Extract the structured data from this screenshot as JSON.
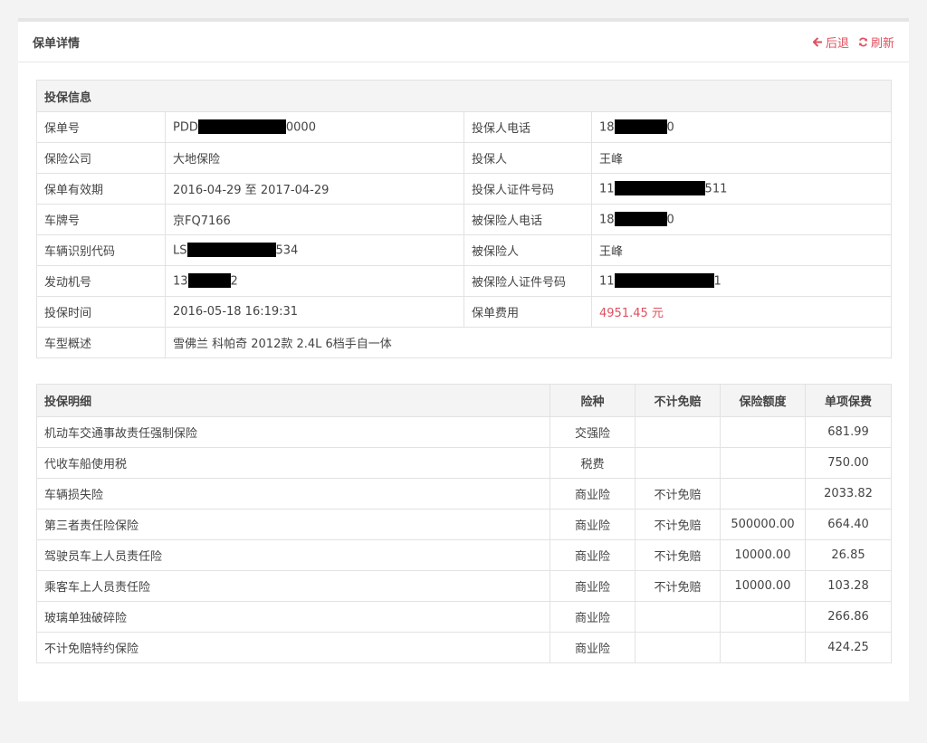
{
  "header": {
    "title": "保单详情",
    "back_label": "后退",
    "refresh_label": "刷新",
    "accent_color": "#e0505f"
  },
  "info": {
    "section_title": "投保信息",
    "rows": [
      {
        "label1": "保单号",
        "value1_prefix": "PDD",
        "value1_suffix": "0000",
        "label2": "投保人电话",
        "value2_prefix": "18",
        "value2_suffix": "0"
      },
      {
        "label1": "保险公司",
        "value1": "大地保险",
        "label2": "投保人",
        "value2": "王峰"
      },
      {
        "label1": "保单有效期",
        "value1": "2016-04-29 至 2017-04-29",
        "label2": "投保人证件号码",
        "value2_prefix": "11",
        "value2_suffix": "511"
      },
      {
        "label1": "车牌号",
        "value1": "京FQ7166",
        "label2": "被保险人电话",
        "value2_prefix": "18",
        "value2_suffix": "0"
      },
      {
        "label1": "车辆识别代码",
        "value1_prefix": "LS",
        "value1_suffix": "534",
        "label2": "被保险人",
        "value2": "王峰"
      },
      {
        "label1": "发动机号",
        "value1_prefix": "13",
        "value1_suffix": "2",
        "label2": "被保险人证件号码",
        "value2_prefix": "11",
        "value2_suffix": "1"
      },
      {
        "label1": "投保时间",
        "value1": "2016-05-18 16:19:31",
        "label2": "保单费用",
        "value2": "4951.45 元"
      },
      {
        "label1": "车型概述",
        "value1": "雪佛兰 科帕奇 2012款 2.4L 6档手自一体"
      }
    ]
  },
  "detail": {
    "headers": [
      "投保明细",
      "险种",
      "不计免赔",
      "保险额度",
      "单项保费"
    ],
    "rows": [
      [
        "机动车交通事故责任强制保险",
        "交强险",
        "",
        "",
        "681.99"
      ],
      [
        "代收车船使用税",
        "税费",
        "",
        "",
        "750.00"
      ],
      [
        "车辆损失险",
        "商业险",
        "不计免赔",
        "",
        "2033.82"
      ],
      [
        "第三者责任险保险",
        "商业险",
        "不计免赔",
        "500000.00",
        "664.40"
      ],
      [
        "驾驶员车上人员责任险",
        "商业险",
        "不计免赔",
        "10000.00",
        "26.85"
      ],
      [
        "乘客车上人员责任险",
        "商业险",
        "不计免赔",
        "10000.00",
        "103.28"
      ],
      [
        "玻璃单独破碎险",
        "商业险",
        "",
        "",
        "266.86"
      ],
      [
        "不计免赔特约保险",
        "商业险",
        "",
        "",
        "424.25"
      ]
    ]
  }
}
